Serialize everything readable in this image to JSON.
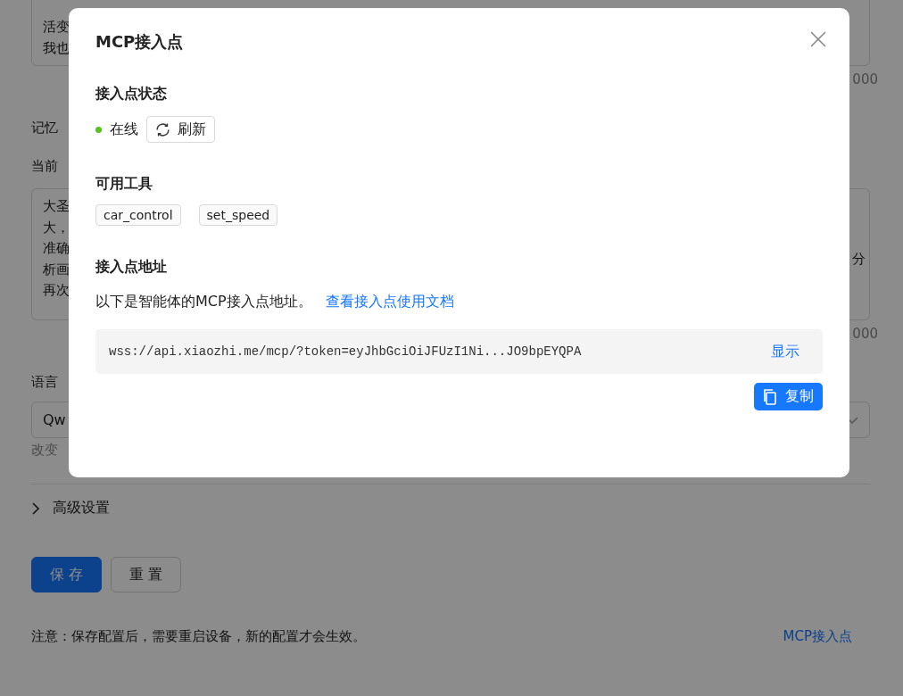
{
  "background": {
    "intro_lines": [
      "活变",
      "我也"
    ],
    "intro_counter": "000",
    "memory_label": "记忆",
    "prompt_label": "当前",
    "prompt_lines": [
      "大圣",
      "大，",
      "准确",
      "析画",
      "再次"
    ],
    "prompt_right_char": "分",
    "prompt_counter": "000",
    "model_label": "语言",
    "model_value": "Qw",
    "model_hint": "改变",
    "advanced": {
      "label": "高级设置",
      "expanded": false
    },
    "buttons": [
      {
        "label": "保 存",
        "kind": "primary"
      },
      {
        "label": "重 置",
        "kind": "default"
      }
    ],
    "note": "注意：保存配置后，需要重启设备，新的配置才会生效。",
    "mcp_link": "MCP接入点"
  },
  "dialog": {
    "title": "MCP接入点",
    "status_section": {
      "title": "接入点状态",
      "status": "在线",
      "online": true,
      "refresh_button": "刷新"
    },
    "tools_section": {
      "title": "可用工具",
      "tools": [
        "car_control",
        "set_speed"
      ]
    },
    "address_section": {
      "title": "接入点地址",
      "description": "以下是智能体的MCP接入点地址。",
      "doc_link": "查看接入点使用文档",
      "url": "wss://api.xiaozhi.me/mcp/?token=eyJhbGciOiJFUzI1Ni...JO9bpEYQPA",
      "show_link": "显示",
      "copy_button": "复制"
    }
  }
}
